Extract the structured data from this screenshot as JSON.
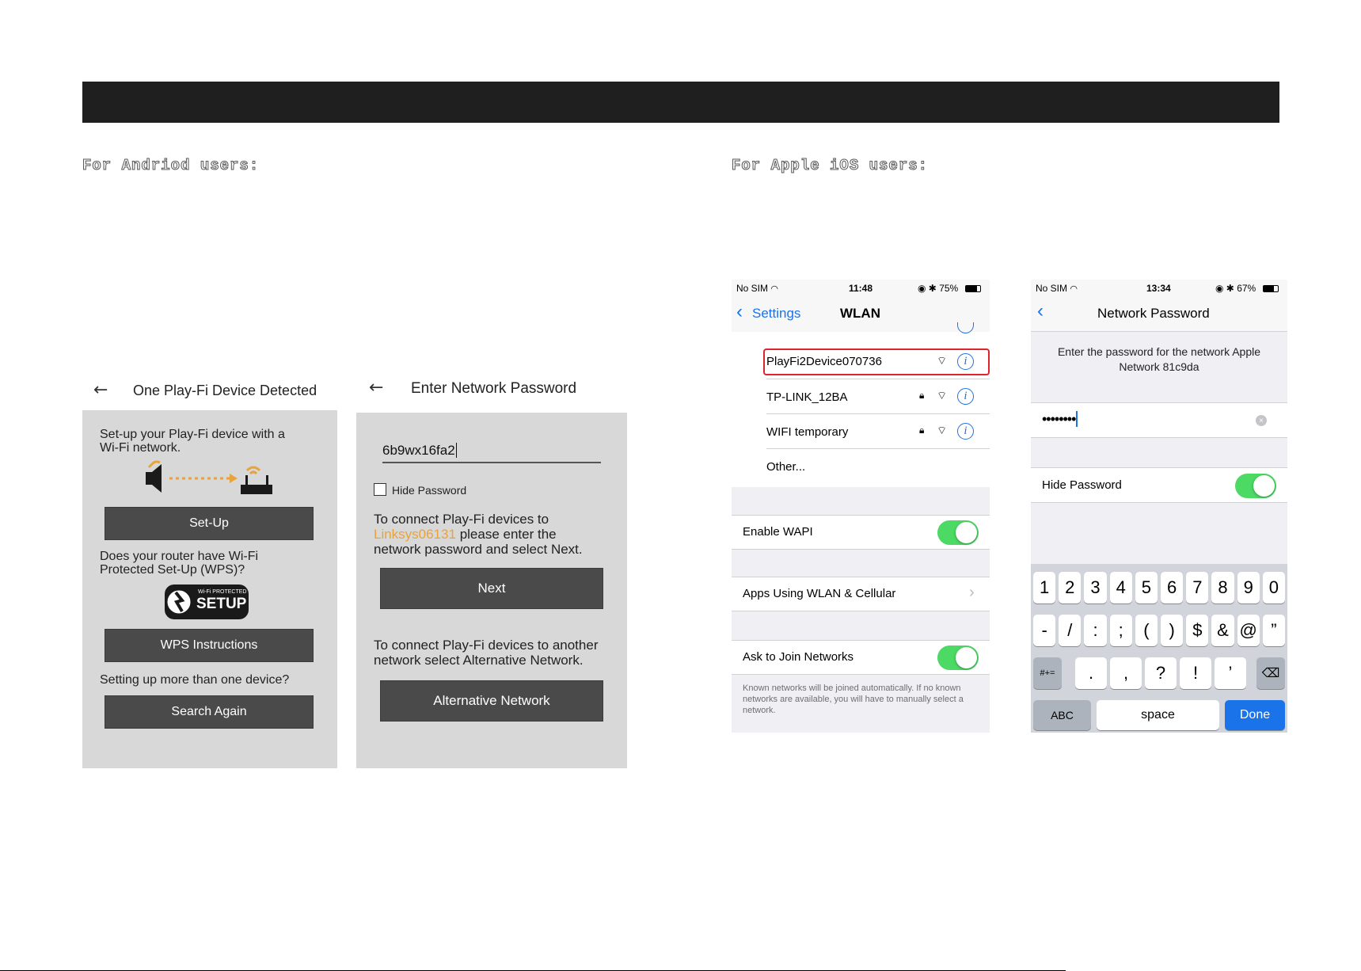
{
  "headings": {
    "android": "For Andriod users:",
    "ios": "For Apple iOS users:"
  },
  "android_screen1": {
    "title": "One Play-Fi Device Detected",
    "setup_text": "Set-up your Play-Fi device with a Wi-Fi network.",
    "setup_button": "Set-Up",
    "wps_question": "Does your router have Wi-Fi Protected Set-Up (WPS)?",
    "wps_logo_small": "Wi-Fi PROTECTED",
    "wps_logo_big": "SETUP",
    "wps_button": "WPS Instructions",
    "multiple_text": "Setting up more than one device?",
    "search_button": "Search Again"
  },
  "android_screen2": {
    "title": "Enter Network Password",
    "password_value": "6b9wx16fa2",
    "hide_password_label": "Hide Password",
    "connect_text_1": "To connect Play-Fi devices to",
    "network_name": "Linksys06131",
    "connect_text_2": "please enter the",
    "connect_text_3": "network password and select Next.",
    "next_button": "Next",
    "alt_text": "To connect Play-Fi devices to another network select Alternative Network.",
    "alt_button": "Alternative Network",
    "accent_color": "#e8a33a"
  },
  "ios_screen1": {
    "status_carrier": "No SIM",
    "status_time": "11:48",
    "status_battery": "75%",
    "back_label": "Settings",
    "title": "WLAN",
    "networks": [
      {
        "name": "PlayFi2Device070736",
        "locked": false,
        "highlighted": true
      },
      {
        "name": "TP-LINK_12BA",
        "locked": true,
        "highlighted": false
      },
      {
        "name": "WIFI temporary",
        "locked": true,
        "highlighted": false
      }
    ],
    "other_label": "Other...",
    "enable_wapi_label": "Enable WAPI",
    "apps_label": "Apps Using WLAN & Cellular",
    "ask_join_label": "Ask to Join Networks",
    "footer_note": "Known networks will be joined automatically. If no known networks are available, you will have to manually select a network.",
    "highlight_color": "#e0242e",
    "toggle_color": "#4cd964"
  },
  "ios_screen2": {
    "status_carrier": "No SIM",
    "status_time": "13:34",
    "status_battery": "67%",
    "title": "Network Password",
    "prompt": "Enter the password for the network Apple Network 81c9da",
    "password_mask": "••••••••",
    "hide_password_label": "Hide Password",
    "keyboard": {
      "row1": [
        "1",
        "2",
        "3",
        "4",
        "5",
        "6",
        "7",
        "8",
        "9",
        "0"
      ],
      "row2": [
        "-",
        "/",
        ":",
        ";",
        "(",
        ")",
        "$",
        "&",
        "@",
        "”"
      ],
      "row3_left": "#+=",
      "row3": [
        ".",
        ",",
        "?",
        "!",
        "’"
      ],
      "abc": "ABC",
      "space": "space",
      "done": "Done"
    }
  }
}
